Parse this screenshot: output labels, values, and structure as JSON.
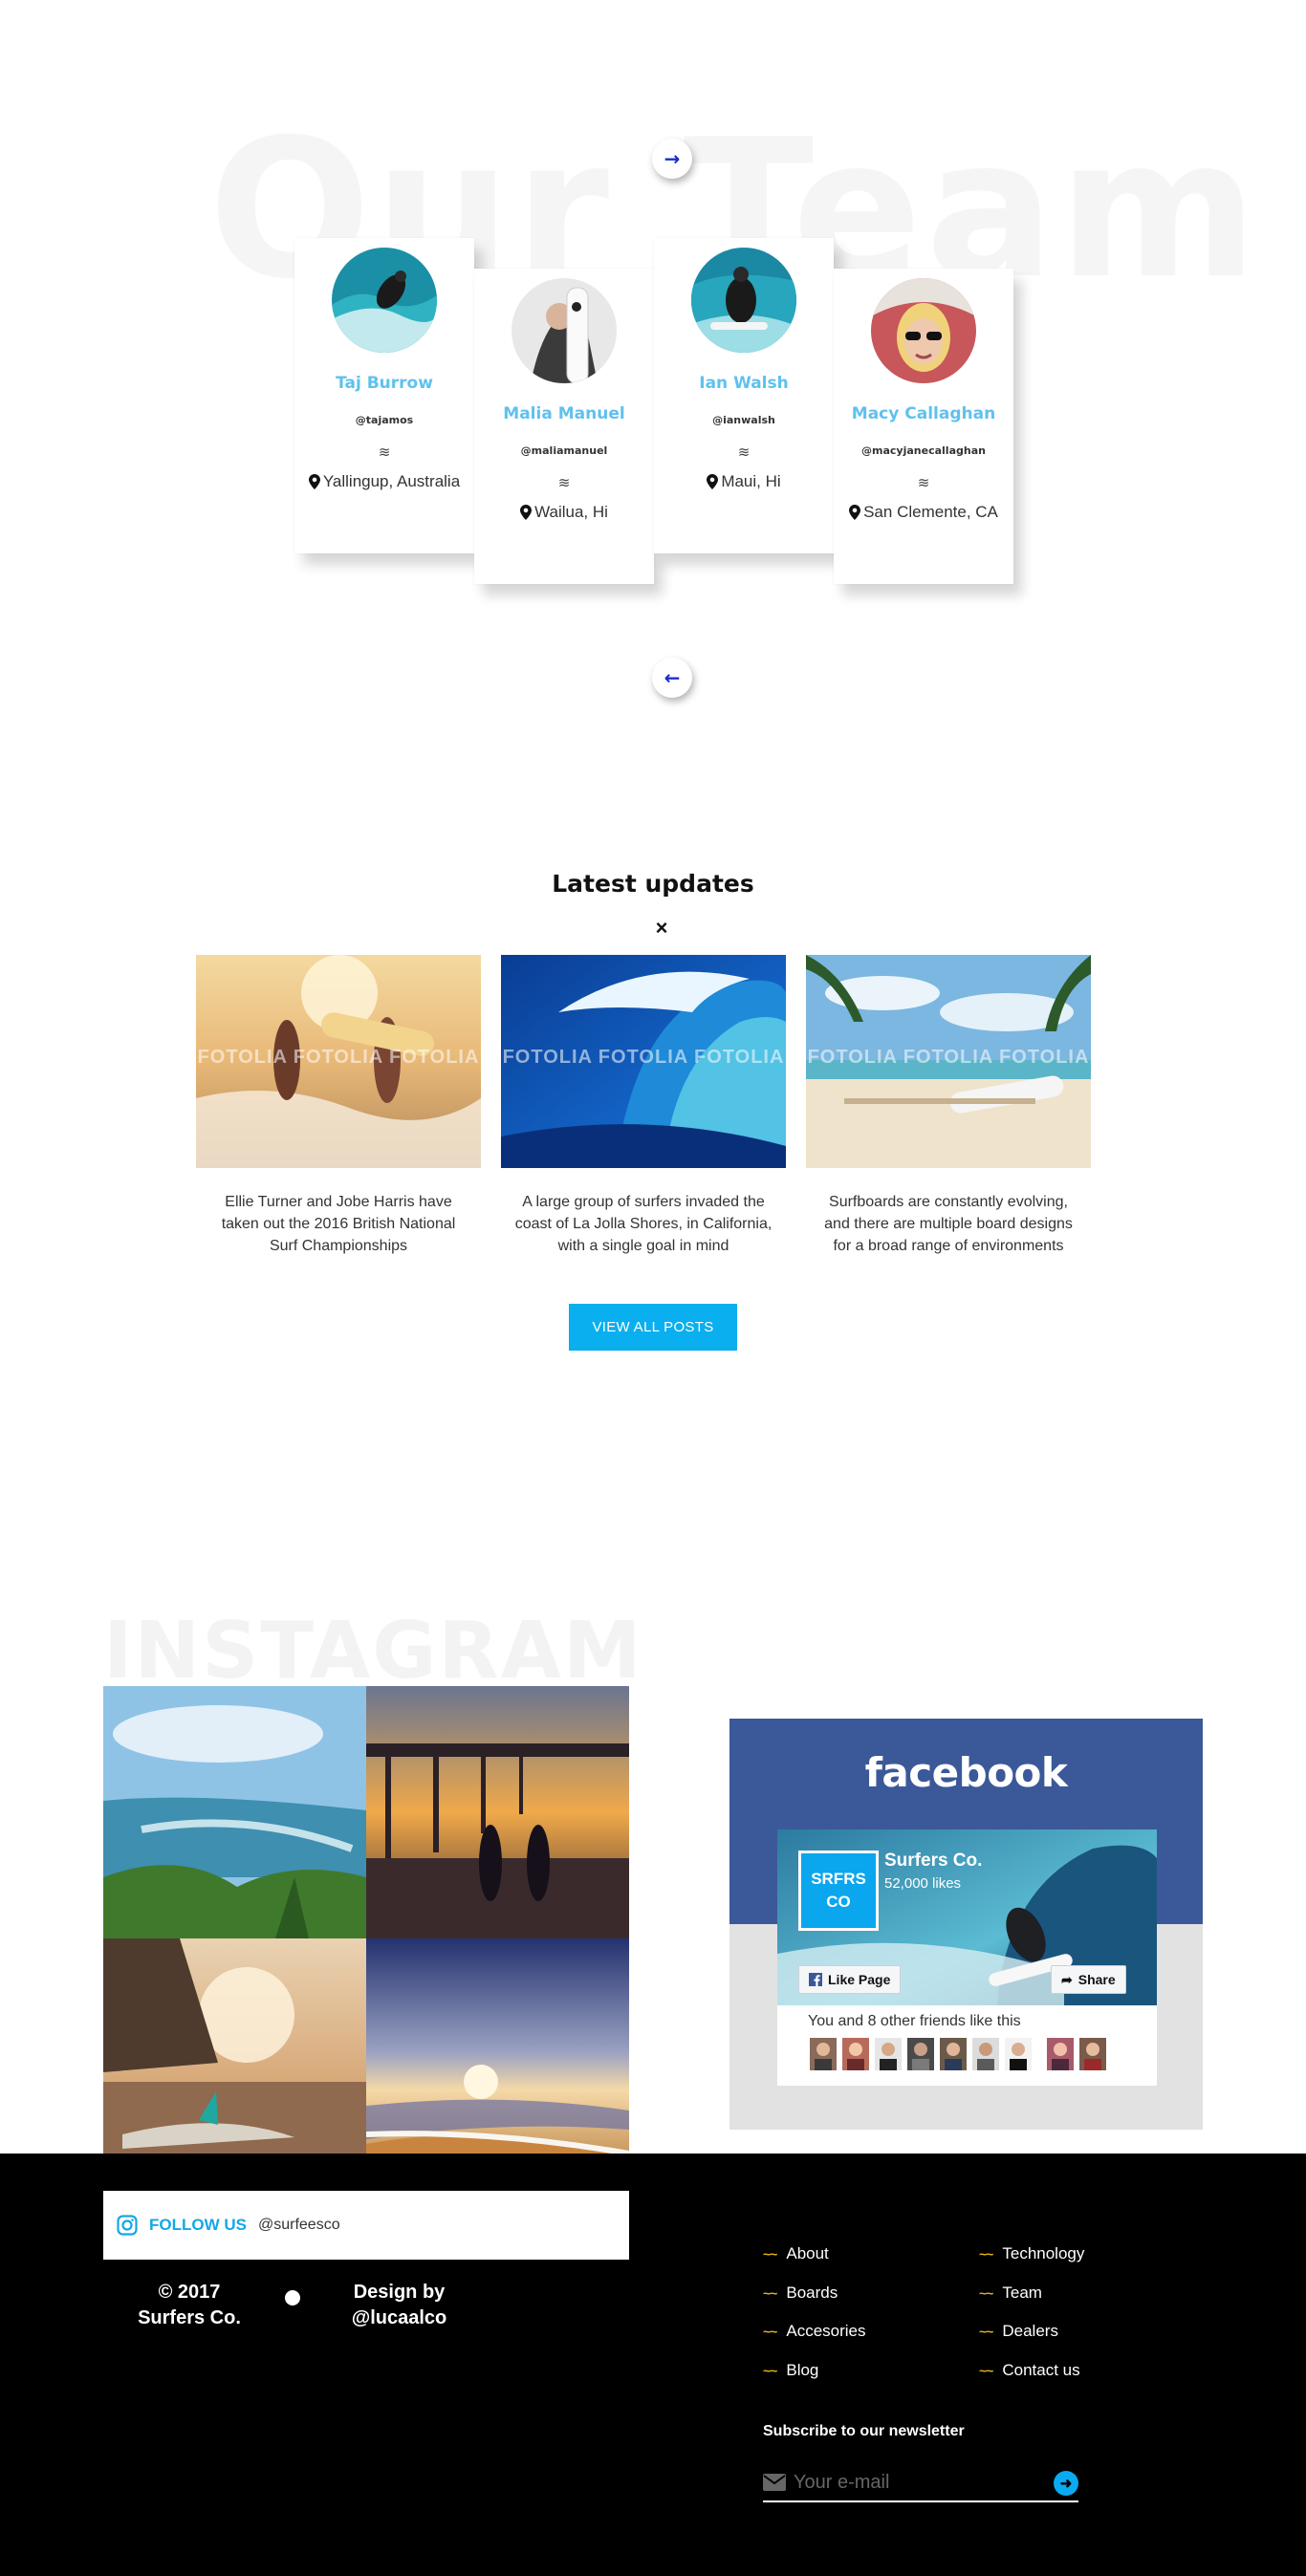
{
  "team": {
    "background_title": "Our Team",
    "next_icon": "arrow-right-icon",
    "prev_icon": "arrow-left-icon",
    "wave_symbol": "≋",
    "members": [
      {
        "name": "Taj Burrow",
        "handle": "@tajamos",
        "location": "Yallingup, Australia"
      },
      {
        "name": "Malia Manuel",
        "handle": "@maliamanuel",
        "location": "Wailua, Hi"
      },
      {
        "name": "Ian Walsh",
        "handle": "@ianwalsh",
        "location": "Maui, Hi"
      },
      {
        "name": "Macy Callaghan",
        "handle": "@macyjanecallaghan",
        "location": "San Clemente, CA"
      }
    ]
  },
  "updates": {
    "title": "Latest updates",
    "close_symbol": "×",
    "watermark": "FOTOLIA FOTOLIA FOTOLIA",
    "posts": [
      {
        "text": "Ellie Turner and Jobe Harris have taken out the 2016 British National Surf Championships"
      },
      {
        "text": "A large group of surfers invaded the coast of La Jolla Shores, in California, with a single goal in mind"
      },
      {
        "text": "Surfboards are constantly evolving, and there are multiple board designs for a broad range of environments"
      }
    ],
    "view_all_label": "VIEW ALL POSTS"
  },
  "instagram": {
    "background_title": "INSTAGRAM",
    "follow_label": "FOLLOW US",
    "handle": "@surfeesco"
  },
  "facebook": {
    "logo_text": "facebook",
    "page_logo": "SRFRS\nCO",
    "page_name": "Surfers Co.",
    "likes": "52,000 likes",
    "like_button": "Like Page",
    "share_button": "Share",
    "friends_text": "You and 8 other friends like this"
  },
  "footer": {
    "copyright": "© 2017\nSurfers Co.",
    "design_by": "Design by\n@lucaalco",
    "links_left": [
      "About",
      "Boards",
      "Accesories",
      "Blog"
    ],
    "links_right": [
      "Technology",
      "Team",
      "Dealers",
      "Contact us"
    ],
    "wavy_symbol": "~~",
    "newsletter_title": "Subscribe to our newsletter",
    "email_placeholder": "Your e-mail"
  },
  "colors": {
    "accent_blue": "#0aafef",
    "name_blue": "#5fc1ee",
    "facebook_blue": "#3b5998",
    "wavy_gold": "#e4b414",
    "footer_bg": "#000000"
  }
}
